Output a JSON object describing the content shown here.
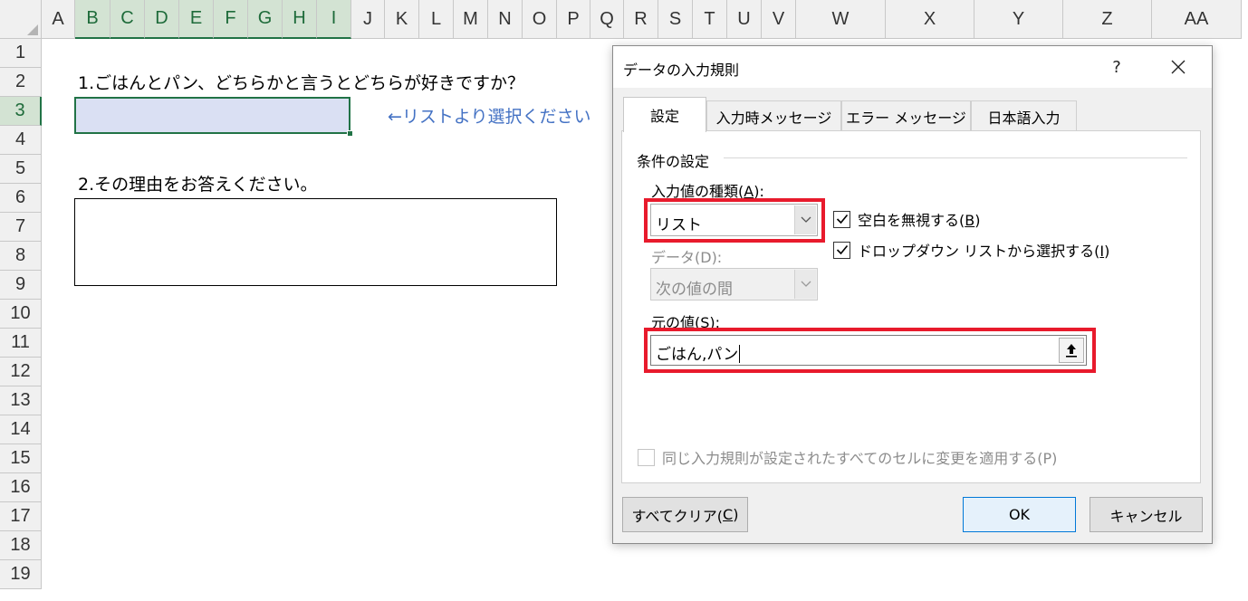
{
  "sheet": {
    "columns": [
      "A",
      "B",
      "C",
      "D",
      "E",
      "F",
      "G",
      "H",
      "I",
      "J",
      "K",
      "L",
      "M",
      "N",
      "O",
      "P",
      "Q",
      "R",
      "S",
      "T",
      "U",
      "V",
      "W",
      "X",
      "Y",
      "Z",
      "AA"
    ],
    "rows": [
      "1",
      "2",
      "3",
      "4",
      "5",
      "6",
      "7",
      "8",
      "9",
      "10",
      "11",
      "12",
      "13",
      "14",
      "15",
      "16",
      "17",
      "18",
      "19"
    ],
    "selected_columns": [
      "B",
      "C",
      "D",
      "E",
      "F",
      "G",
      "H",
      "I"
    ],
    "selected_row": "3",
    "question1": "1.ごはんとパン、どちらかと言うとどちらが好きですか？",
    "hint": "←リストより選択ください",
    "question2": "2.その理由をお答えください。",
    "colors": {
      "selection_green": "#217346",
      "hint_blue": "#4472c4",
      "input_fill": "#dae0f3"
    }
  },
  "dialog": {
    "title": "データの入力規則",
    "help_label": "?",
    "tabs": [
      {
        "label": "設定",
        "active": true
      },
      {
        "label": "入力時メッセージ",
        "active": false
      },
      {
        "label": "エラー メッセージ",
        "active": false
      },
      {
        "label": "日本語入力",
        "active": false
      }
    ],
    "settings": {
      "group_label": "条件の設定",
      "allow_label": "入力値の種類(",
      "allow_key": "A",
      "allow_suffix": "):",
      "allow_value": "リスト",
      "ignore_blank_label": "空白を無視する(",
      "ignore_blank_key": "B",
      "ignore_blank_suffix": ")",
      "ignore_blank_checked": true,
      "dropdown_label": "ドロップダウン リストから選択する(",
      "dropdown_key": "I",
      "dropdown_suffix": ")",
      "dropdown_checked": true,
      "data_label": "データ(D):",
      "data_value": "次の値の間",
      "source_label": "元の値(",
      "source_key": "S",
      "source_suffix": "):",
      "source_value": "ごはん,パン",
      "apply_all_label": "同じ入力規則が設定されたすべてのセルに変更を適用する(P)",
      "apply_all_checked": false,
      "highlight_color": "#e81a2c"
    },
    "buttons": {
      "clear_label": "すべてクリア(",
      "clear_key": "C",
      "clear_suffix": ")",
      "ok_label": "OK",
      "cancel_label": "キャンセル"
    }
  }
}
